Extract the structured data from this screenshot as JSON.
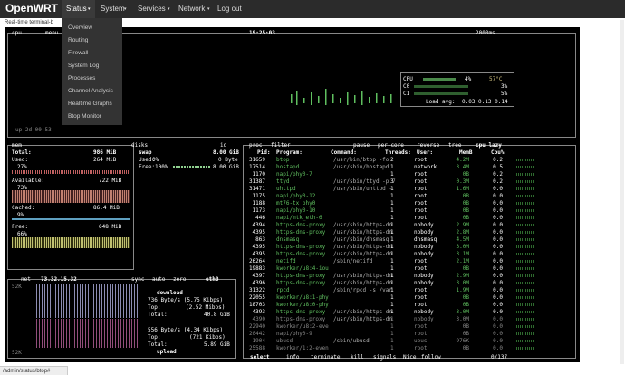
{
  "nav": {
    "brand": "OpenWRT",
    "items": [
      "Status",
      "System",
      "Services",
      "Network",
      "Log out"
    ]
  },
  "dropdown": [
    "Overview",
    "Routing",
    "Firewall",
    "System Log",
    "Processes",
    "Channel Analysis",
    "Realtime Graphs",
    "Btop Monitor"
  ],
  "subtitle": "Real-time terminal-b",
  "status_url": "/admin/status/btop#",
  "cpu": {
    "title": "cpu",
    "menu": "menu",
    "clock": "19:25:03",
    "interval": "2000ms",
    "uptime": "up 2d 00:53",
    "rows": [
      {
        "label": "CPU",
        "pct": "4%",
        "temp": "57°C"
      },
      {
        "label": "C0",
        "pct": "3%"
      },
      {
        "label": "C1",
        "pct": "5%"
      }
    ],
    "load_label": "Load avg:",
    "load": "0.03 0.13 0.14"
  },
  "mem": {
    "title": "mem",
    "total_label": "Total:",
    "total": "986 MiB",
    "used_label": "Used:",
    "used": "264 MiB",
    "used_pct": "27%",
    "avail_label": "Available:",
    "avail": "722 MiB",
    "avail_pct": "73%",
    "cached_label": "Cached:",
    "cached": "86.4 MiB",
    "cached_pct": "9%",
    "free_label": "Free:",
    "free": "648 MiB",
    "free_pct": "66%"
  },
  "disks": {
    "title": "disks",
    "io": "io",
    "swap_label": "swap",
    "swap_total": "8.00 GiB",
    "used_label": "Used:",
    "used_pct": "0%",
    "used": "0 Byte",
    "free_label": "Free:100%",
    "free": "8.00 GiB"
  },
  "net": {
    "title": "net",
    "ip": "73.32.15.32",
    "sync": "sync",
    "auto": "auto",
    "zero": "zero",
    "iface": "eth0",
    "top_scale": "52K",
    "bottom_scale": "52K",
    "download_label": "download",
    "dl_rate": "736 Byte/s (5.75 Kibps)",
    "dl_top_label": "Top:",
    "dl_top": "(2.52 Mibps)",
    "dl_total_label": "Total:",
    "dl_total": "40.8 GiB",
    "upload_label": "upload",
    "ul_rate": "556 Byte/s (4.34 Kibps)",
    "ul_top_label": "Top:",
    "ul_top": "(721 Kibps)",
    "ul_total_label": "Total:",
    "ul_total": "5.89 GiB"
  },
  "proc": {
    "title": "proc",
    "filter": "filter",
    "pause": "pause",
    "per_core": "per-core",
    "reverse": "reverse",
    "tree": "tree",
    "cpu_lazy": "cpu lazy",
    "headers": {
      "pid": "Pid:",
      "program": "Program:",
      "command": "Command:",
      "threads": "Threads:",
      "user": "User:",
      "mem": "MemB",
      "cpu": "Cpu%"
    },
    "rows": [
      {
        "pid": "31659",
        "program": "btop",
        "command": "/usr/bin/btop -fo",
        "threads": "2",
        "user": "root",
        "mem": "4.2M",
        "cpu": "0.2"
      },
      {
        "pid": "17514",
        "program": "hostapd",
        "command": "/usr/sbin/hostapd",
        "threads": "1",
        "user": "network",
        "mem": "3.4M",
        "cpu": "0.5"
      },
      {
        "pid": "1170",
        "program": "napi/phy0-7",
        "command": "",
        "threads": "1",
        "user": "root",
        "mem": "0B",
        "cpu": "0.2"
      },
      {
        "pid": "31387",
        "program": "ttyd",
        "command": "/usr/sbin/ttyd -p 7",
        "threads": "3",
        "user": "root",
        "mem": "0.3M",
        "cpu": "0.2"
      },
      {
        "pid": "31471",
        "program": "uhttpd",
        "command": "/usr/sbin/uhttpd -",
        "threads": "1",
        "user": "root",
        "mem": "1.6M",
        "cpu": "0.0"
      },
      {
        "pid": "1175",
        "program": "napi/phy0-12",
        "command": "",
        "threads": "1",
        "user": "root",
        "mem": "0B",
        "cpu": "0.0"
      },
      {
        "pid": "1188",
        "program": "mt76-tx phy0",
        "command": "",
        "threads": "1",
        "user": "root",
        "mem": "0B",
        "cpu": "0.0"
      },
      {
        "pid": "1173",
        "program": "napi/phy0-10",
        "command": "",
        "threads": "1",
        "user": "root",
        "mem": "0B",
        "cpu": "0.0"
      },
      {
        "pid": "446",
        "program": "napi/mtk_eth-6",
        "command": "",
        "threads": "1",
        "user": "root",
        "mem": "0B",
        "cpu": "0.0"
      },
      {
        "pid": "4394",
        "program": "https-dns-proxy",
        "command": "/usr/sbin/https-dn",
        "threads": "1",
        "user": "nobody",
        "mem": "2.9M",
        "cpu": "0.0"
      },
      {
        "pid": "4395",
        "program": "https-dns-proxy",
        "command": "/usr/sbin/https-dn",
        "threads": "1",
        "user": "nobody",
        "mem": "2.8M",
        "cpu": "0.0"
      },
      {
        "pid": "863",
        "program": "dnsmasq",
        "command": "/usr/sbin/dnsmasq",
        "threads": "1",
        "user": "dnsmasq",
        "mem": "4.5M",
        "cpu": "0.0"
      },
      {
        "pid": "4395",
        "program": "https-dns-proxy",
        "command": "/usr/sbin/https-dn",
        "threads": "1",
        "user": "nobody",
        "mem": "3.0M",
        "cpu": "0.0"
      },
      {
        "pid": "4395",
        "program": "https-dns-proxy",
        "command": "/usr/sbin/https-dn",
        "threads": "1",
        "user": "nobody",
        "mem": "3.1M",
        "cpu": "0.0"
      },
      {
        "pid": "26264",
        "program": "netifd",
        "command": "/sbin/netifd",
        "threads": "1",
        "user": "root",
        "mem": "2.1M",
        "cpu": "0.0"
      },
      {
        "pid": "19883",
        "program": "kworker/u8:4-iou",
        "command": "",
        "threads": "1",
        "user": "root",
        "mem": "0B",
        "cpu": "0.0"
      },
      {
        "pid": "4397",
        "program": "https-dns-proxy",
        "command": "/usr/sbin/https-dn",
        "threads": "1",
        "user": "nobody",
        "mem": "2.9M",
        "cpu": "0.0"
      },
      {
        "pid": "4396",
        "program": "https-dns-proxy",
        "command": "/usr/sbin/https-dn",
        "threads": "1",
        "user": "nobody",
        "mem": "3.0M",
        "cpu": "0.0"
      },
      {
        "pid": "31322",
        "program": "rpcd",
        "command": "/sbin/rpcd -s /var",
        "threads": "1",
        "user": "root",
        "mem": "1.9M",
        "cpu": "0.0"
      },
      {
        "pid": "22055",
        "program": "kworker/u8:1-phy",
        "command": "",
        "threads": "1",
        "user": "root",
        "mem": "0B",
        "cpu": "0.0"
      },
      {
        "pid": "18703",
        "program": "kworker/u8:0-phy",
        "command": "",
        "threads": "1",
        "user": "root",
        "mem": "0B",
        "cpu": "0.0"
      },
      {
        "pid": "4393",
        "program": "https-dns-proxy",
        "command": "/usr/sbin/https-dn",
        "threads": "1",
        "user": "nobody",
        "mem": "3.0M",
        "cpu": "0.0"
      },
      {
        "pid": "4390",
        "program": "https-dns-proxy",
        "command": "/usr/sbin/https-dn",
        "threads": "1",
        "user": "nobody",
        "mem": "3.0M",
        "cpu": "0.0"
      },
      {
        "pid": "22940",
        "program": "kworker/u8:2-eve",
        "command": "",
        "threads": "1",
        "user": "root",
        "mem": "0B",
        "cpu": "0.0"
      },
      {
        "pid": "20442",
        "program": "napi/phy0-9",
        "command": "",
        "threads": "1",
        "user": "root",
        "mem": "0B",
        "cpu": "0.0"
      },
      {
        "pid": "1904",
        "program": "ubusd",
        "command": "/sbin/ubusd",
        "threads": "1",
        "user": "ubus",
        "mem": "976K",
        "cpu": "0.0"
      },
      {
        "pid": "25588",
        "program": "kworker/1:2-even",
        "command": "",
        "threads": "1",
        "user": "root",
        "mem": "0B",
        "cpu": "0.0"
      }
    ],
    "footer": {
      "select": "select",
      "info": "info",
      "terminate": "terminate",
      "kill": "kill",
      "signals": "signals",
      "nice": "Nice",
      "follow": "follow",
      "count": "0/137"
    }
  },
  "colors": {
    "nav_bg": "#2b2b2b",
    "term_bg": "#000000",
    "accent_green": "#5fbf5f"
  }
}
